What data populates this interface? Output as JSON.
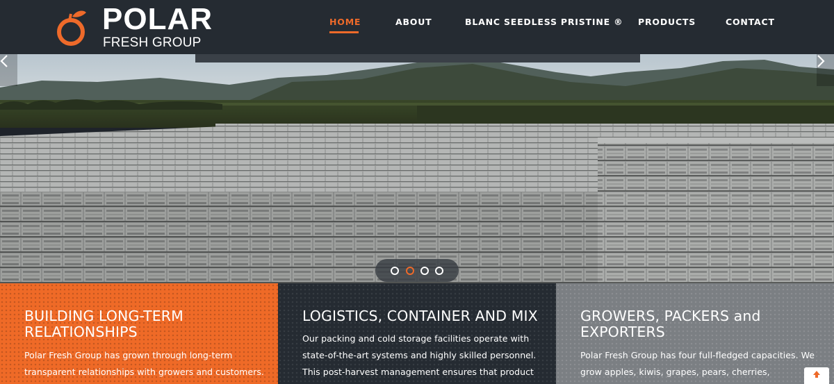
{
  "brand": {
    "name": "POLAR",
    "sub": "FRESH GROUP",
    "accent": "#ee6a2a"
  },
  "nav": {
    "items": [
      {
        "label": "HOME",
        "active": true
      },
      {
        "label": "ABOUT"
      },
      {
        "label": "BLANC SEEDLESS PRISTINE ®"
      },
      {
        "label": "PRODUCTS"
      },
      {
        "label": "CONTACT"
      }
    ]
  },
  "hero": {
    "slides": 4,
    "active_slide": 2,
    "prev_icon": "chevron-left-icon",
    "next_icon": "chevron-right-icon"
  },
  "panels": [
    {
      "title": "BUILDING LONG-TERM RELATIONSHIPS",
      "text": "Polar Fresh Group has grown through long-term transparent relationships with growers and customers.",
      "color": "#ef6a27"
    },
    {
      "title": "LOGISTICS, CONTAINER AND MIX",
      "text": "Our packing and cold storage facilities operate with state-of-the-art systems and highly skilled personnel. This post-harvest management ensures that product",
      "color": "#252b32"
    },
    {
      "title": "GROWERS, PACKERS and EXPORTERS",
      "text": "Polar Fresh Group has four full-fledged capacities. We grow apples, kiwis, grapes, pears, cherries,",
      "color": "#7b7f83"
    }
  ],
  "back_to_top_icon": "arrow-up-icon"
}
